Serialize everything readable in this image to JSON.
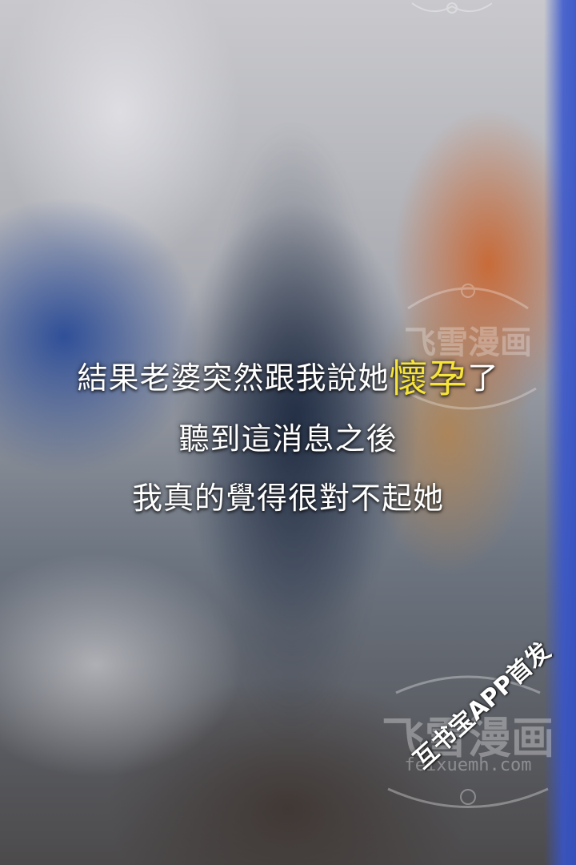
{
  "caption": {
    "line1_before": "結果老婆突然跟我說她",
    "line1_highlight": "懷孕",
    "line1_after": "了",
    "line2": "聽到這消息之後",
    "line3": "我真的覺得很對不起她",
    "highlight_color": "#f6e43a"
  },
  "watermark": {
    "title": "飞雪漫画",
    "site": "feixuemh.com",
    "repost_notice": "互书宝APP首发"
  }
}
